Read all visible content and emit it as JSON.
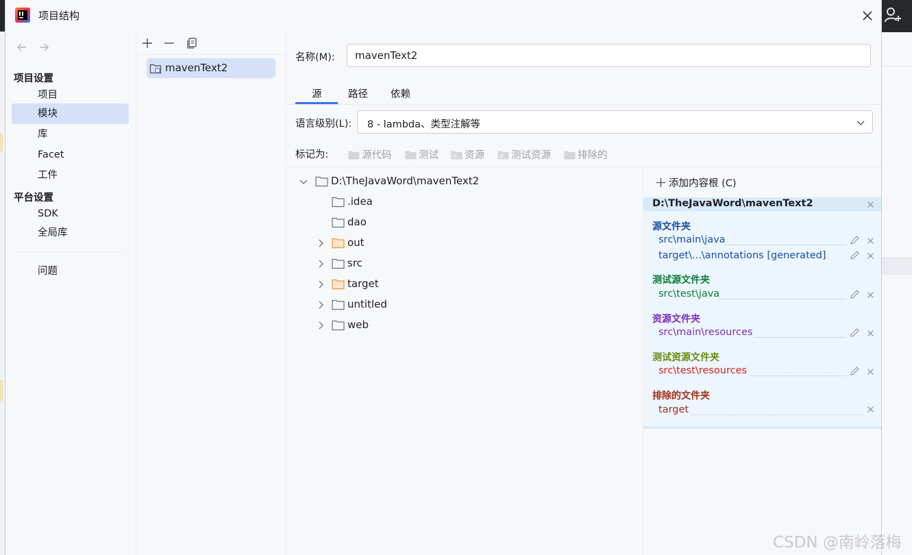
{
  "window": {
    "title": "项目结构"
  },
  "nav": {
    "project_settings_header": "项目设置",
    "project_settings_items": [
      "项目",
      "模块",
      "库",
      "Facet",
      "工件"
    ],
    "selected": "模块",
    "platform_settings_header": "平台设置",
    "platform_settings_items": [
      "SDK",
      "全局库"
    ],
    "problems": "问题"
  },
  "modules": {
    "items": [
      "mavenText2"
    ]
  },
  "name_field": {
    "label": "名称(M):",
    "value": "mavenText2"
  },
  "tabs": {
    "items": [
      "源",
      "路径",
      "依赖"
    ],
    "active": "源"
  },
  "language_level": {
    "label": "语言级别(L):",
    "value": "8 - lambda、类型注解等"
  },
  "mark_as": {
    "label": "标记为:",
    "buttons": [
      "源代码",
      "测试",
      "资源",
      "测试资源",
      "排除的"
    ]
  },
  "tree": {
    "root": "D:\\TheJavaWord\\mavenText2",
    "children": [
      {
        "name": ".idea",
        "expandable": false,
        "color": "gray"
      },
      {
        "name": "dao",
        "expandable": false,
        "color": "gray"
      },
      {
        "name": "out",
        "expandable": true,
        "color": "orange"
      },
      {
        "name": "src",
        "expandable": true,
        "color": "gray"
      },
      {
        "name": "target",
        "expandable": true,
        "color": "orange"
      },
      {
        "name": "untitled",
        "expandable": true,
        "color": "gray"
      },
      {
        "name": "web",
        "expandable": true,
        "color": "gray"
      }
    ]
  },
  "content_roots": {
    "add_label": "添加内容根 (C)",
    "root_path": "D:\\TheJavaWord\\mavenText2",
    "groups": [
      {
        "title": "源文件夹",
        "color": "#174ea6",
        "entries": [
          "src\\main\\java",
          "target\\...\\annotations [generated]"
        ]
      },
      {
        "title": "测试源文件夹",
        "color": "#0a7d3b",
        "entries": [
          "src\\test\\java"
        ]
      },
      {
        "title": "资源文件夹",
        "color": "#7b2fbe",
        "entries": [
          "src\\main\\resources"
        ]
      },
      {
        "title": "测试资源文件夹",
        "color": "#6a8d12",
        "entries": [
          "src\\test\\resources"
        ]
      },
      {
        "title": "排除的文件夹",
        "color": "#a3311a",
        "entries": [
          "target"
        ]
      }
    ]
  },
  "watermark": "CSDN @南岭落梅"
}
